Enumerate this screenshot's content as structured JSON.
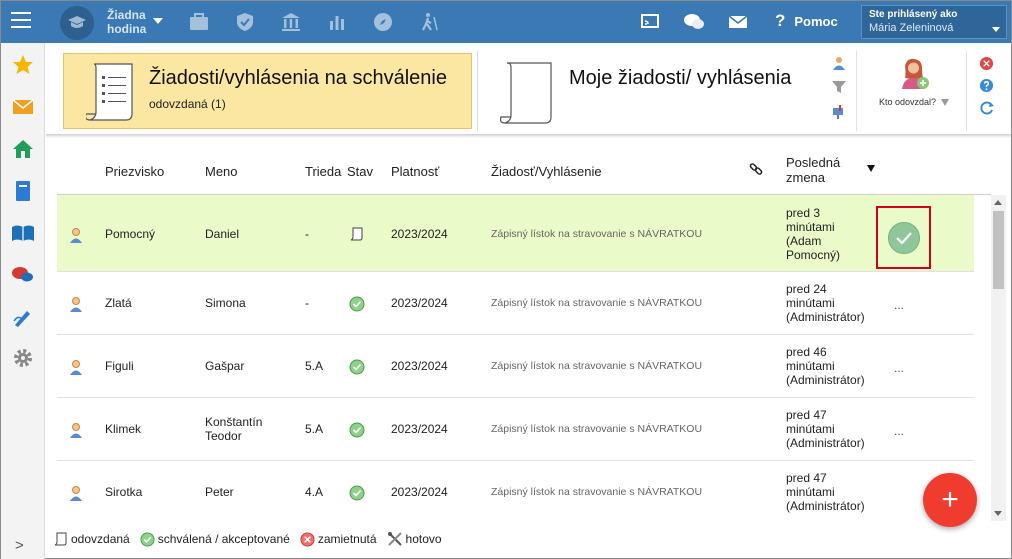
{
  "topbar": {
    "hour_selector": "Žiadna hodina",
    "help_label": "Pomoc",
    "help_glyph": "?",
    "user_prefix": "Ste prihlásený ako",
    "user_name": "Mária Zeleninová"
  },
  "colors": {
    "topbar": "#3a79b3",
    "active_card": "#fbe6a2",
    "row_highlight": "#eafac8",
    "approve_outline": "#d0021b",
    "fab": "#f03c2e"
  },
  "cards": {
    "active_title": "Žiadosti/vyhlásenia na schválenie",
    "active_subtitle": "odovzdaná (1)",
    "other_title": "Moje žiadosti/ vyhlásenia",
    "who_label": "Kto odovzdal?"
  },
  "table": {
    "headers": {
      "surname": "Priezvisko",
      "name": "Meno",
      "class": "Trieda",
      "status": "Stav",
      "validity": "Platnosť",
      "request": "Žiadosť/Vyhlásenie",
      "last_change_1": "Posledná",
      "last_change_2": "zmena"
    },
    "rows": [
      {
        "surname": "Pomocný",
        "name": "Daniel",
        "name2": "",
        "class": "-",
        "status": "odovzdaná",
        "validity": "2023/2024",
        "request": "Zápisný lístok na stravovanie s NÁVRATKOU",
        "change": [
          "pred 3",
          "minútami",
          "(Adam",
          "Pomocný)"
        ],
        "action": ""
      },
      {
        "surname": "Zlatá",
        "name": "Simona",
        "name2": "",
        "class": "-",
        "status": "schválená",
        "validity": "2023/2024",
        "request": "Zápisný lístok na stravovanie s NÁVRATKOU",
        "change": [
          "pred 24",
          "minútami",
          "(Administrátor)",
          ""
        ],
        "action": "..."
      },
      {
        "surname": "Figuli",
        "name": "Gašpar",
        "name2": "",
        "class": "5.A",
        "status": "schválená",
        "validity": "2023/2024",
        "request": "Zápisný lístok na stravovanie s NÁVRATKOU",
        "change": [
          "pred 46",
          "minútami",
          "(Administrátor)",
          ""
        ],
        "action": "..."
      },
      {
        "surname": "Klimek",
        "name": "Konštantín",
        "name2": "Teodor",
        "class": "5.A",
        "status": "schválená",
        "validity": "2023/2024",
        "request": "Zápisný lístok na stravovanie s NÁVRATKOU",
        "change": [
          "pred 47",
          "minútami",
          "(Administrátor)",
          ""
        ],
        "action": "..."
      },
      {
        "surname": "Sirotka",
        "name": "Peter",
        "name2": "",
        "class": "4.A",
        "status": "schválená",
        "validity": "2023/2024",
        "request": "Zápisný lístok na stravovanie s NÁVRATKOU",
        "change": [
          "pred 47",
          "minútami",
          "(Administrátor)",
          ""
        ],
        "action": "..."
      }
    ]
  },
  "fab_label": "+",
  "legend": {
    "submitted": "odovzdaná",
    "approved": "schválená / akceptované",
    "rejected": "zamietnutá",
    "done": "hotovo"
  }
}
